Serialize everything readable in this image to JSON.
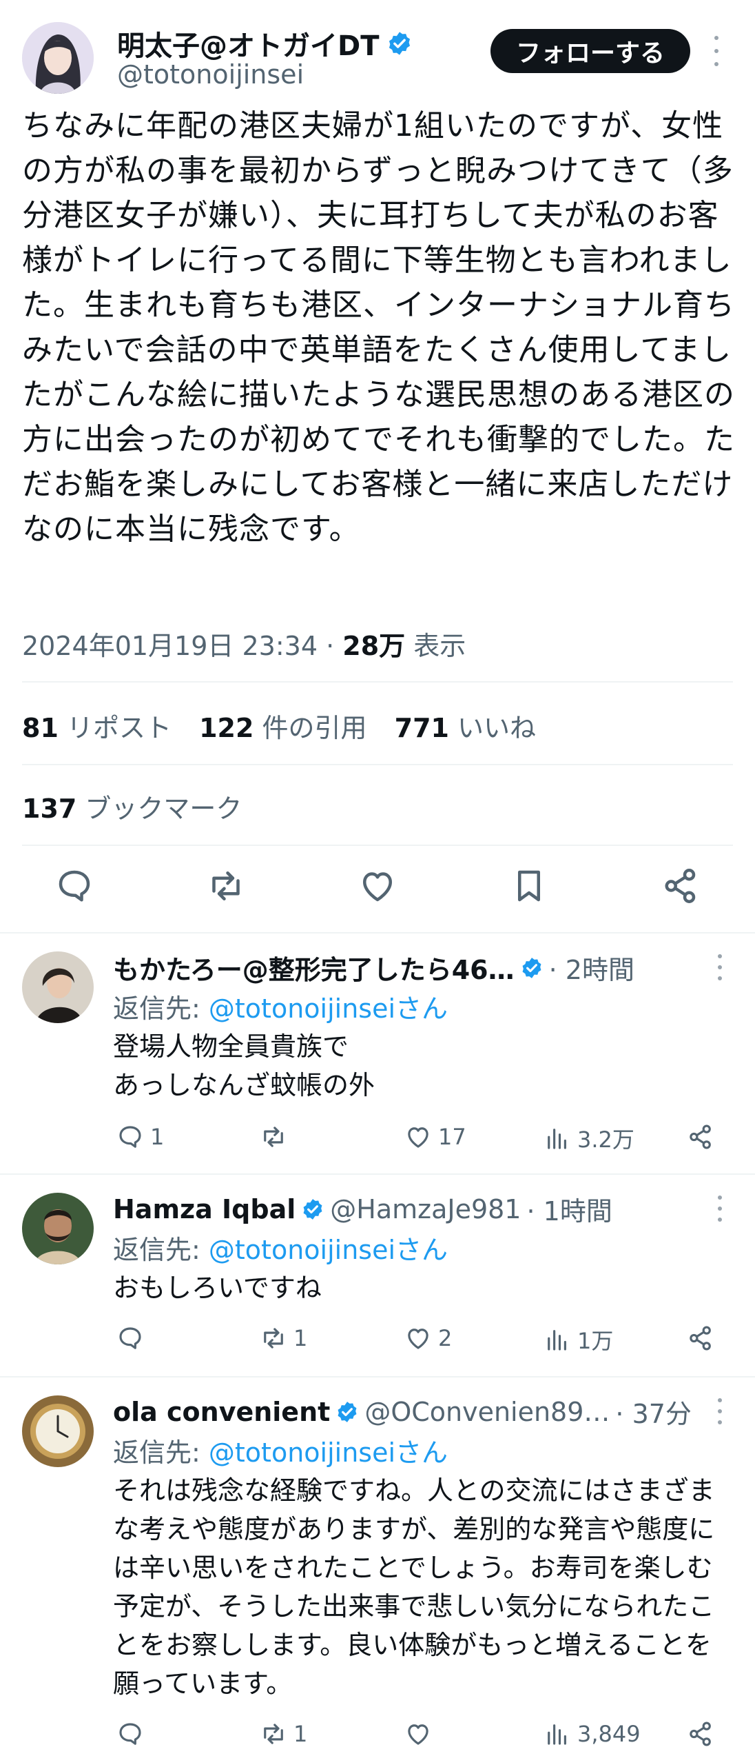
{
  "main_tweet": {
    "author_name": "明太子@オトガイDT",
    "handle": "@totonoijinsei",
    "follow_label": "フォローする",
    "text": "ちなみに年配の港区夫婦が1組いたのですが、女性の方が私の事を最初からずっと睨みつけてきて（多分港区女子が嫌い）、夫に耳打ちして夫が私のお客様がトイレに行ってる間に下等生物とも言われました。生まれも育ちも港区、インターナショナル育ちみたいで会話の中で英単語をたくさん使用してましたがこんな絵に描いたような選民思想のある港区の方に出会ったのが初めてでそれも衝撃的でした。ただお鮨を楽しみにしてお客様と一緒に来店しただけなのに本当に残念です。",
    "timestamp": "2024年01月19日 23:34",
    "views_count": "28万",
    "views_label": "表示",
    "reposts_count": "81",
    "reposts_label": "リポスト",
    "quotes_count": "122",
    "quotes_label": "件の引用",
    "likes_count": "771",
    "likes_label": "いいね",
    "bookmarks_count": "137",
    "bookmarks_label": "ブックマーク"
  },
  "replies": [
    {
      "name": "もかたろー@整形完了したら46…",
      "handle": "",
      "time": "· 2時間",
      "reply_to_label": "返信先:",
      "reply_to_handle": "@totonoijinseiさん",
      "text": "登場人物全員貴族で\nあっしなんざ蚊帳の外",
      "reply_count": "1",
      "repost_count": "",
      "like_count": "17",
      "view_count": "3.2万"
    },
    {
      "name": "Hamza Iqbal",
      "handle": "@HamzaJe981",
      "time": "· 1時間",
      "reply_to_label": "返信先:",
      "reply_to_handle": "@totonoijinseiさん",
      "text": "おもしろいですね",
      "reply_count": "",
      "repost_count": "1",
      "like_count": "2",
      "view_count": "1万"
    },
    {
      "name": "ola convenient",
      "handle": "@OConvenien89…",
      "time": "· 37分",
      "reply_to_label": "返信先:",
      "reply_to_handle": "@totonoijinseiさん",
      "text": "それは残念な経験ですね。人との交流にはさまざまな考えや態度がありますが、差別的な発言や態度には辛い思いをされたことでしょう。お寿司を楽しむ予定が、そうした出来事で悲しい気分になられたことをお察しします。良い体験がもっと増えることを願っています。",
      "reply_count": "",
      "repost_count": "1",
      "like_count": "",
      "view_count": "3,849"
    }
  ],
  "colors": {
    "accent": "#1d9bf0",
    "text": "#0f1419",
    "secondary": "#536471",
    "divider": "#eff3f4"
  },
  "icons": [
    "verified-badge-icon",
    "more-icon",
    "reply-icon",
    "repost-icon",
    "like-icon",
    "bookmark-icon",
    "share-icon",
    "views-icon"
  ]
}
